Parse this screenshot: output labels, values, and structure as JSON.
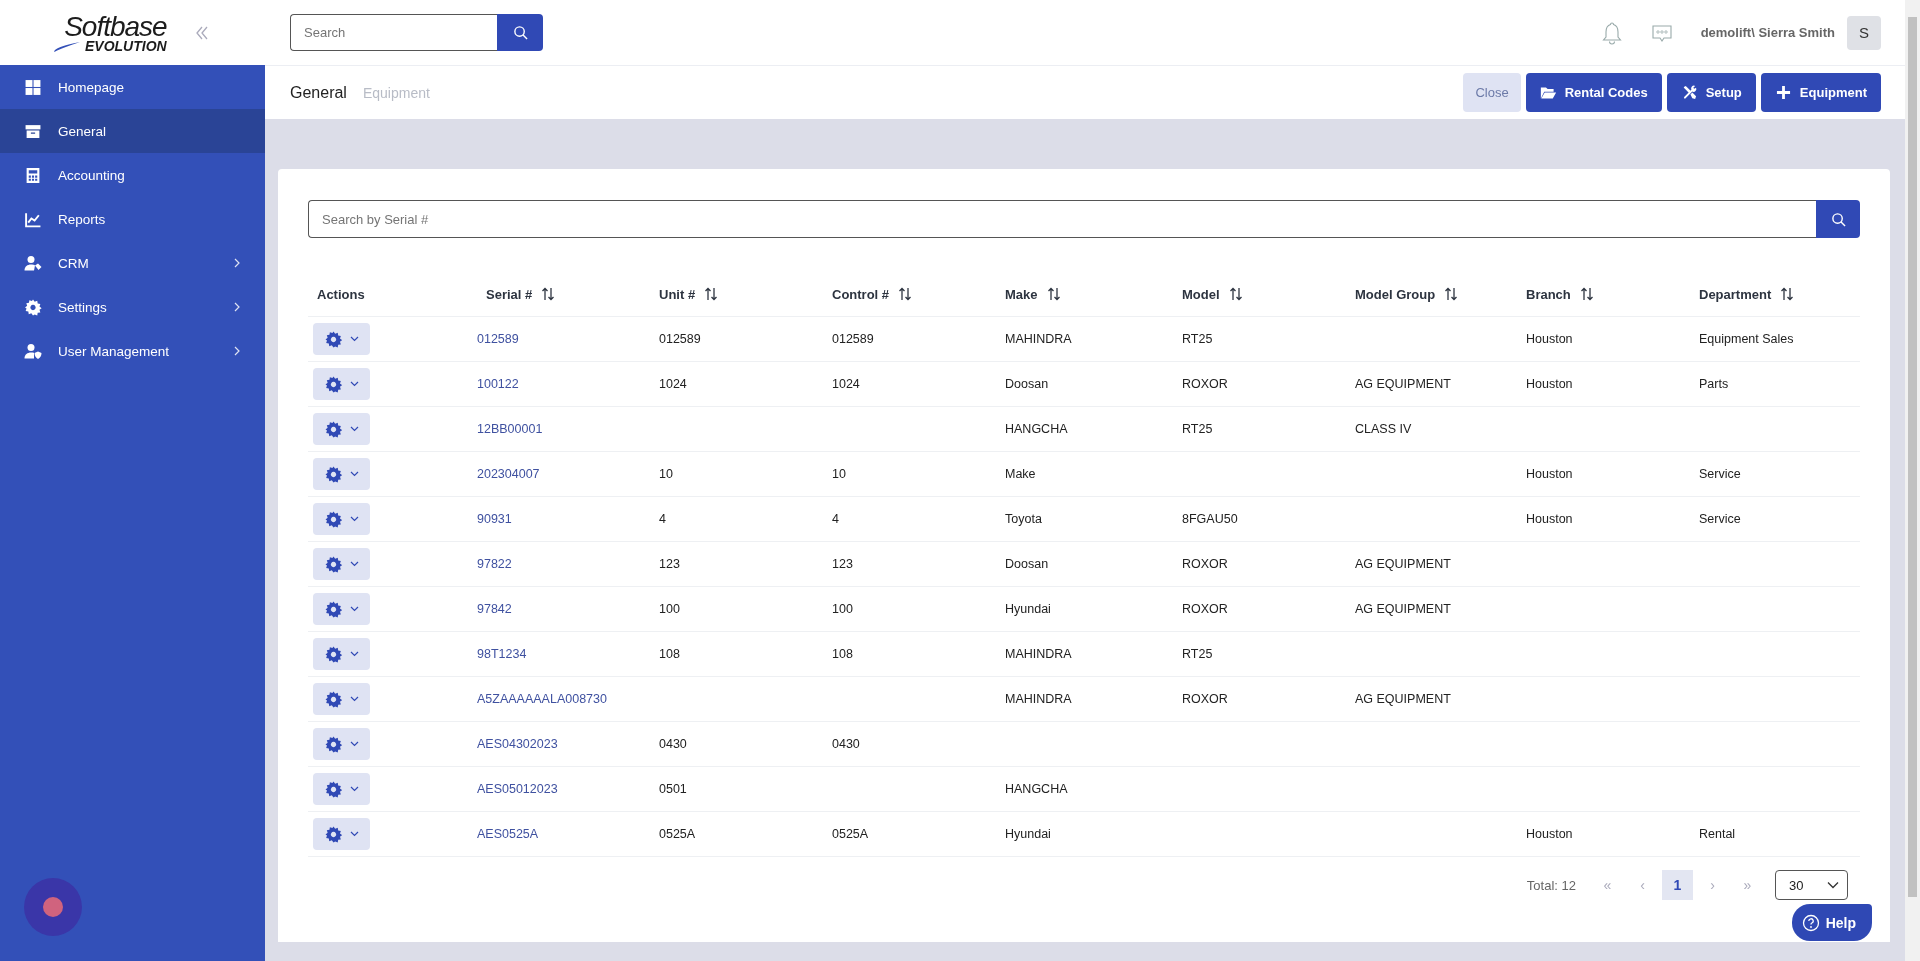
{
  "logo": {
    "name": "Softbase",
    "tagline": "EVOLUTION"
  },
  "sidebar": {
    "items": [
      {
        "label": "Homepage",
        "kind": "grid",
        "selected": false,
        "expandable": false
      },
      {
        "label": "General",
        "kind": "archive",
        "selected": true,
        "expandable": false
      },
      {
        "label": "Accounting",
        "kind": "calculator",
        "selected": false,
        "expandable": false
      },
      {
        "label": "Reports",
        "kind": "chart",
        "selected": false,
        "expandable": false
      },
      {
        "label": "CRM",
        "kind": "user-tag",
        "selected": false,
        "expandable": true
      },
      {
        "label": "Settings",
        "kind": "gear",
        "selected": false,
        "expandable": true
      },
      {
        "label": "User Management",
        "kind": "user-shield",
        "selected": false,
        "expandable": true
      }
    ]
  },
  "top_bar": {
    "search": {
      "placeholder": "Search"
    },
    "user": "demolift\\ Sierra Smith",
    "avatar": "S"
  },
  "breadcrumb": [
    {
      "label": "General",
      "current": true
    },
    {
      "label": "Equipment",
      "current": false
    }
  ],
  "actions": [
    {
      "label": "Close",
      "kind": "secondary"
    },
    {
      "label": "Rental Codes",
      "kind": "folder"
    },
    {
      "label": "Setup",
      "kind": "tools"
    },
    {
      "label": "Equipment",
      "kind": "plus"
    }
  ],
  "table": {
    "search": {
      "placeholder": "Search by Serial #"
    },
    "columns": [
      {
        "label": "Actions",
        "sortable": false
      },
      {
        "label": "Serial #",
        "sortable": true
      },
      {
        "label": "Unit #",
        "sortable": true
      },
      {
        "label": "Control #",
        "sortable": true
      },
      {
        "label": "Make",
        "sortable": true
      },
      {
        "label": "Model",
        "sortable": true
      },
      {
        "label": "Model Group",
        "sortable": true
      },
      {
        "label": "Branch",
        "sortable": true
      },
      {
        "label": "Department",
        "sortable": true
      }
    ],
    "rows": [
      {
        "serial": "012589",
        "unit": "012589",
        "control": "012589",
        "make": "MAHINDRA",
        "model": "RT25",
        "branch": "Houston",
        "department": "Equipment Sales"
      },
      {
        "serial": "100122",
        "unit": "1024",
        "control": "1024",
        "make": "Doosan",
        "model": "ROXOR",
        "model_group": "AG EQUIPMENT",
        "branch": "Houston",
        "department": "Parts"
      },
      {
        "serial": "12BB00001",
        "make": "HANGCHA",
        "model": "RT25",
        "model_group": "CLASS IV"
      },
      {
        "serial": "202304007",
        "unit": "10",
        "control": "10",
        "make": "Make",
        "branch": "Houston",
        "department": "Service"
      },
      {
        "serial": "90931",
        "unit": "4",
        "control": "4",
        "make": "Toyota",
        "model": "8FGAU50",
        "branch": "Houston",
        "department": "Service"
      },
      {
        "serial": "97822",
        "unit": "123",
        "control": "123",
        "make": "Doosan",
        "model": "ROXOR",
        "model_group": "AG EQUIPMENT"
      },
      {
        "serial": "97842",
        "unit": "100",
        "control": "100",
        "make": "Hyundai",
        "model": "ROXOR",
        "model_group": "AG EQUIPMENT"
      },
      {
        "serial": "98T1234",
        "unit": "108",
        "control": "108",
        "make": "MAHINDRA",
        "model": "RT25"
      },
      {
        "serial": "A5ZAAAAAALA008730",
        "make": "MAHINDRA",
        "model": "ROXOR",
        "model_group": "AG EQUIPMENT"
      },
      {
        "serial": "AES04302023",
        "unit": "0430",
        "control": "0430"
      },
      {
        "serial": "AES05012023",
        "unit": "0501",
        "make": "HANGCHA"
      },
      {
        "serial": "AES0525A",
        "unit": "0525A",
        "control": "0525A",
        "make": "Hyundai",
        "branch": "Houston",
        "department": "Rental"
      }
    ]
  },
  "pagination": {
    "total": "Total: 12",
    "first": "«",
    "prev": "‹",
    "pages": [
      {
        "label": "1",
        "selected": true
      }
    ],
    "next": "›",
    "last": "»",
    "page_size": "30"
  },
  "help": {
    "label": "Help"
  }
}
